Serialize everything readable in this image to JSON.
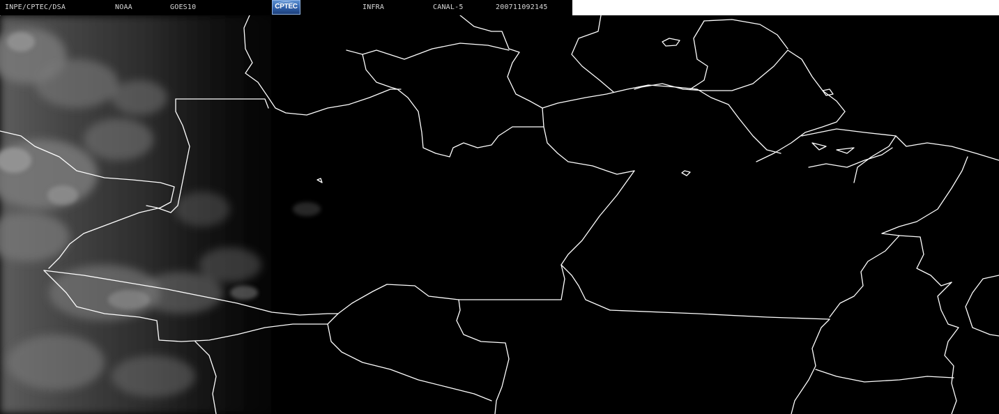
{
  "header": {
    "agency": "INPE/CPTEC/DSA",
    "provider": "NOAA",
    "satellite": "GOES10",
    "logo_text": "CPTEC",
    "product": "INFRA",
    "channel": "CANAL-5",
    "datetime": "200711092145"
  },
  "map": {
    "background_color": "#000000",
    "border_color": "#ffffff",
    "cloud_color": "#8a8a8a",
    "layers": [
      "satellite-infrared-image",
      "political-borders"
    ]
  }
}
